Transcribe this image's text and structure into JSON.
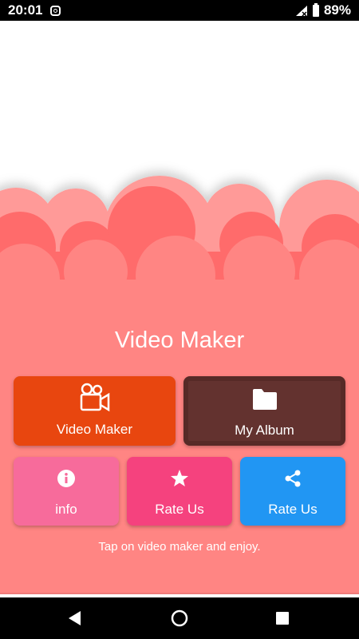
{
  "status_bar": {
    "time": "20:01",
    "battery": "89%",
    "icons": [
      "instagram-icon",
      "signal-icon",
      "battery-icon"
    ]
  },
  "app": {
    "title": "Video Maker",
    "tagline": "Tap on video maker and enjoy."
  },
  "buttons": {
    "video_maker": {
      "label": "Video Maker",
      "icon": "video-camera-icon",
      "color": "#e8460f"
    },
    "my_album": {
      "label": "My Album",
      "icon": "folder-icon",
      "color": "#63322f"
    },
    "info": {
      "label": "info",
      "icon": "info-icon",
      "color": "#f76b9b"
    },
    "rate_us": {
      "label": "Rate Us",
      "icon": "star-icon",
      "color": "#f5427e"
    },
    "share": {
      "label": "Rate Us",
      "icon": "share-icon",
      "color": "#2196f3"
    }
  },
  "colors": {
    "background_pink": "#ff8583",
    "cloud_dark": "#ff6b6b",
    "cloud_light": "#ff9a98"
  },
  "nav_bar": {
    "icons": [
      "back-icon",
      "home-icon",
      "recents-icon"
    ]
  }
}
